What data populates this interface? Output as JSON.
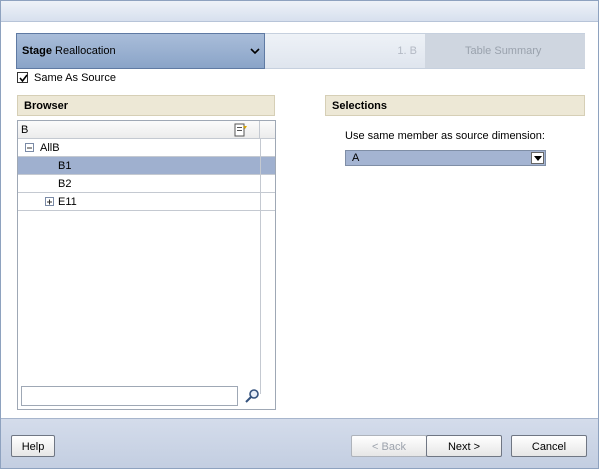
{
  "stage": {
    "prefix": "Stage",
    "name": "Reallocation"
  },
  "steps": [
    {
      "label": "1. B"
    },
    {
      "label": "Table Summary"
    }
  ],
  "same_as_source": {
    "label": "Same As Source",
    "checked": true
  },
  "browser": {
    "title": "Browser",
    "search_value": "B",
    "tree": [
      {
        "label": "AllB",
        "expander": "minus"
      },
      {
        "label": "B1",
        "selected": true
      },
      {
        "label": "B2"
      },
      {
        "label": "E11",
        "expander": "plus"
      }
    ],
    "filter_placeholder": ""
  },
  "selections": {
    "title": "Selections",
    "prompt": "Use same member as source dimension:",
    "selected_value": "A"
  },
  "footer": {
    "help": "Help",
    "back": "< Back",
    "next": "Next >",
    "cancel": "Cancel"
  },
  "colors": {
    "stage_bg": "#8aa4c8",
    "selected_row": "#9fb0cf",
    "panel_head": "#ede8d6",
    "footer_bg": "#c3cee1"
  },
  "icons": [
    "chevron-down-icon",
    "checkmark-icon",
    "filter-icon",
    "collapse-icon",
    "expand-icon",
    "search-icon",
    "dropdown-arrow-icon"
  ]
}
